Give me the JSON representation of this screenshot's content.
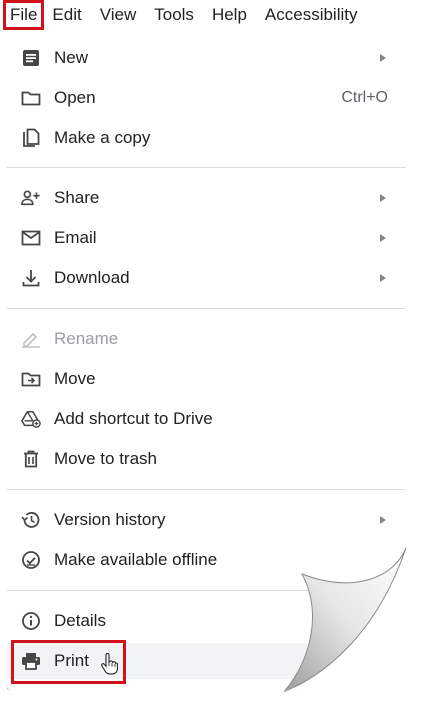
{
  "menubar": {
    "items": [
      "File",
      "Edit",
      "View",
      "Tools",
      "Help",
      "Accessibility"
    ]
  },
  "file_menu": {
    "items": [
      {
        "label": "New",
        "icon": "document-icon",
        "submenu": true
      },
      {
        "label": "Open",
        "icon": "folder-icon",
        "shortcut": "Ctrl+O"
      },
      {
        "label": "Make a copy",
        "icon": "copy-icon"
      },
      {
        "label": "Share",
        "icon": "person-add-icon",
        "submenu": true
      },
      {
        "label": "Email",
        "icon": "email-icon",
        "submenu": true
      },
      {
        "label": "Download",
        "icon": "download-icon",
        "submenu": true
      },
      {
        "label": "Rename",
        "icon": "rename-icon",
        "disabled": true
      },
      {
        "label": "Move",
        "icon": "move-folder-icon"
      },
      {
        "label": "Add shortcut to Drive",
        "icon": "drive-shortcut-icon"
      },
      {
        "label": "Move to trash",
        "icon": "trash-icon"
      },
      {
        "label": "Version history",
        "icon": "history-icon",
        "submenu": true
      },
      {
        "label": "Make available offline",
        "icon": "offline-check-icon"
      },
      {
        "label": "Details",
        "icon": "info-icon"
      },
      {
        "label": "Print",
        "icon": "printer-icon"
      }
    ]
  },
  "colors": {
    "highlight": "#d0121b",
    "text": "#202124",
    "disabled": "#9aa0a6",
    "icon": "#444746"
  }
}
